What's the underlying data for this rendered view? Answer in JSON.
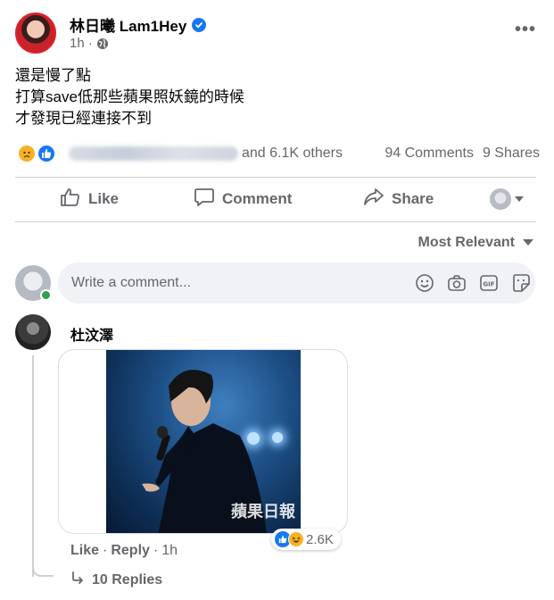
{
  "post": {
    "author_name": "林日曦 Lam1Hey",
    "time": "1h",
    "meta_separator": "·",
    "text_lines": [
      "還是慢了點",
      "打算save低那些蘋果照妖鏡的時候",
      "才發現已經連接不到"
    ]
  },
  "reactions": {
    "others_text": "and 6.1K others",
    "comments": "94 Comments",
    "shares": "9 Shares"
  },
  "actions": {
    "like": "Like",
    "comment": "Comment",
    "share": "Share"
  },
  "sort": {
    "label": "Most Relevant"
  },
  "composer": {
    "placeholder": "Write a comment..."
  },
  "comment": {
    "author": "杜汶澤",
    "watermark": "蘋果日報",
    "reaction_count": "2.6K",
    "like": "Like",
    "reply": "Reply",
    "separator": "·",
    "time": "1h",
    "replies": "10 Replies"
  },
  "colors": {
    "accent": "#1877f2",
    "muted": "#65676b",
    "online": "#31a24c"
  }
}
